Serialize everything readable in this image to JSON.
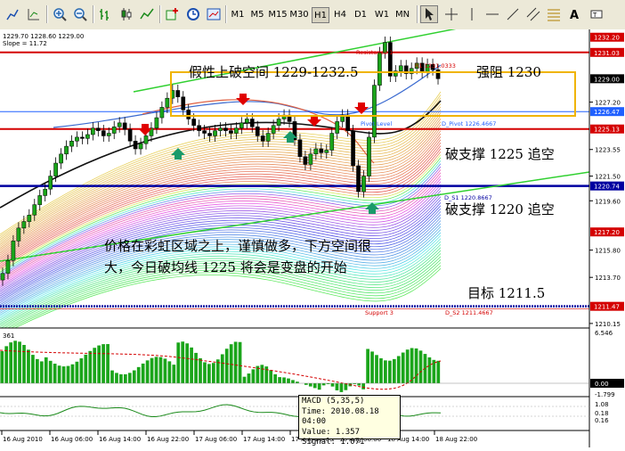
{
  "toolbar": {
    "tools": [
      "line-chart-icon",
      "zoom-in-icon",
      "zoom-out-icon",
      "bar-chart-icon",
      "candle-chart-icon",
      "line-chart-icon",
      "add-indicator-icon",
      "period-icon",
      "template-icon"
    ],
    "timeframes": [
      "M1",
      "M5",
      "M15",
      "M30",
      "H1",
      "H4",
      "D1",
      "W1",
      "MN"
    ],
    "active_timeframe": "H1",
    "cursor_tools": [
      "cursor-icon",
      "crosshair-icon"
    ]
  },
  "chart": {
    "header": "1229.70  1228.60  1229.00",
    "slope_label": "Slope = 11.72",
    "resistance_label": "Resistance 1",
    "r1_value_label": "R1 1231.0333",
    "pivot_label": "Pivot Level",
    "pivot_value_label": "D_Pivot 1226.4667",
    "s1_value_label": "D_S1 1220.8667",
    "support_label": "Support 3",
    "s2_value_label": "D_S2 1211.4667",
    "price_levels": [
      "1232.20",
      "1231.03",
      "1229.00",
      "1227.20",
      "1226.47",
      "1225.13",
      "1223.55",
      "1221.50",
      "1220.74",
      "1219.60",
      "1217.20",
      "1215.80",
      "1213.70",
      "1211.47",
      "1210.15"
    ],
    "price_colors": {
      "resistance": "#d40000",
      "pivot": "#2060ff",
      "support": "#0000a0",
      "current": "#000000",
      "target": "#d40000",
      "rainbow_red": "#e03030"
    },
    "highlighted_prices": [
      "1232.20",
      "1231.03",
      "1229.00",
      "1226.47",
      "1225.13",
      "1220.74",
      "1217.20",
      "1211.47"
    ]
  },
  "annotations": {
    "fake_break": "假性上破空间 1229-1232.5",
    "strong_resistance": "强阻 1230",
    "break_1225": "破支撑 1225 追空",
    "break_1220": "破支撑 1220 追空",
    "main_note": "价格在彩虹区域之上，谨慎做多，下方空间很大，今日破均线 1225 将会是变盘的开始",
    "target": "目标 1211.5"
  },
  "macd": {
    "label": "361",
    "axis_labels": [
      "6.546",
      "0.00",
      "-1.799"
    ],
    "tooltip": {
      "title": "MACD  (5,35,5)",
      "time": "Time: 2010.08.18 04:00",
      "value": "Value: 1.357",
      "signal": "Signal: 1.071"
    }
  },
  "sub_indicator": {
    "axis_labels": [
      "1.08",
      "0.18",
      "0.16"
    ]
  },
  "time_axis": [
    "16 Aug 2010",
    "16 Aug 06:00",
    "16 Aug 14:00",
    "16 Aug 22:00",
    "17 Aug 06:00",
    "17 Aug 14:00",
    "17 Aug 22:00",
    "18 Aug 06:00",
    "18 Aug 14:00",
    "18 Aug 22:00"
  ]
}
